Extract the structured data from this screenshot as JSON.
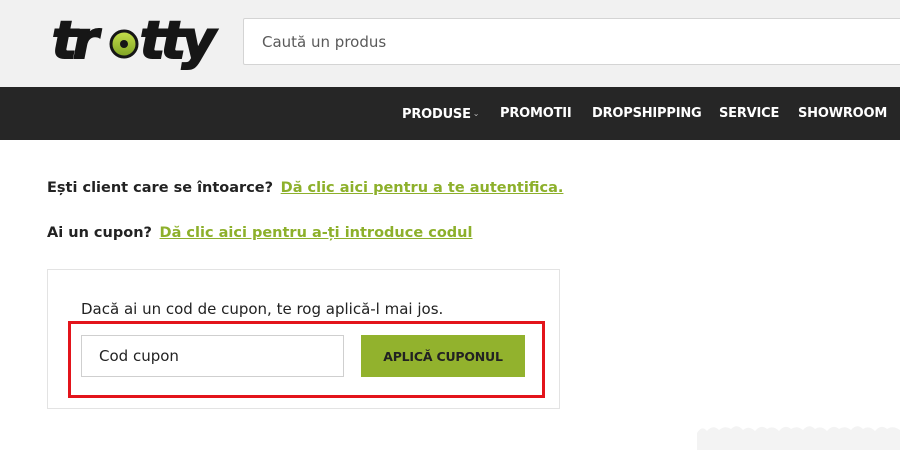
{
  "brand": {
    "logo_text": "trotty",
    "primary": "#1b1b1b",
    "accent": "#8db02b"
  },
  "search": {
    "placeholder": "Caută un produs"
  },
  "nav": {
    "items": [
      {
        "label": "PRODUSE",
        "has_dropdown": true
      },
      {
        "label": "PROMOTII"
      },
      {
        "label": "DROPSHIPPING"
      },
      {
        "label": "SERVICE"
      },
      {
        "label": "SHOWROOM"
      }
    ],
    "dropdown_icon": "chevron-down-icon"
  },
  "checkout": {
    "returning_prompt": "Ești client care se întoarce?",
    "returning_link": "Dă clic aici pentru a te autentifica.",
    "coupon_prompt": "Ai un cupon?",
    "coupon_link": "Dă clic aici pentru a-ți introduce codul",
    "coupon_note": "Dacă ai un cod de cupon, te rog aplică-l mai jos.",
    "coupon_placeholder": "Cod cupon",
    "apply_label": "APLICĂ CUPONUL"
  },
  "colors": {
    "nav_bg": "#262626",
    "link": "#8db02b",
    "button": "#92b22d",
    "highlight": "#e3141b"
  }
}
